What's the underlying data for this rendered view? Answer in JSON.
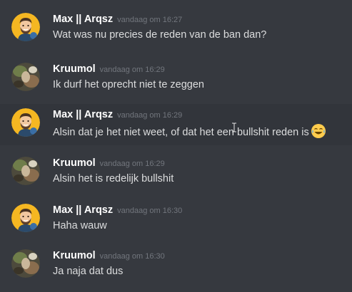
{
  "messages": [
    {
      "author": "Max || Arqsz",
      "time": "vandaag om 16:27",
      "text": "Wat was nu precies de reden van de ban dan?"
    },
    {
      "author": "Kruumol",
      "time": "vandaag om 16:29",
      "text": "Ik durf het oprecht niet te zeggen"
    },
    {
      "author": "Max || Arqsz",
      "time": "vandaag om 16:29",
      "text": "Alsin dat je het niet weet, of dat het een bullshit reden is",
      "emoji": "joy-emoji"
    },
    {
      "author": "Kruumol",
      "time": "vandaag om 16:29",
      "text": "Alsin het is redelijk bullshit"
    },
    {
      "author": "Max || Arqsz",
      "time": "vandaag om 16:30",
      "text": "Haha wauw"
    },
    {
      "author": "Kruumol",
      "time": "vandaag om 16:30",
      "text": "Ja naja dat dus"
    }
  ],
  "colors": {
    "background": "#36393f",
    "highlight": "#32353b",
    "username": "#ffffff",
    "timestamp": "#72767d",
    "text": "#dcddde"
  }
}
